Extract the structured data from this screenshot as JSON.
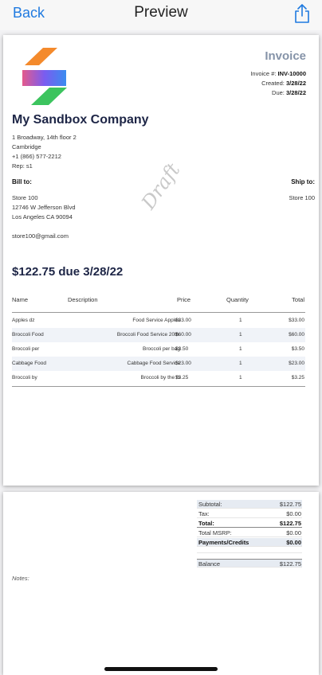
{
  "nav": {
    "back_label": "Back",
    "title": "Preview",
    "share_icon": "share-icon"
  },
  "invoice": {
    "title": "Invoice",
    "number_label": "Invoice #:",
    "number": "INV-10000",
    "created_label": "Created:",
    "created": "3/28/22",
    "due_label": "Due:",
    "due": "3/28/22"
  },
  "company": {
    "name": "My Sandbox Company",
    "address1": "1 Broadway, 14th floor 2",
    "city": "Cambridge",
    "phone": "+1 (866) 577-2212",
    "rep": "Rep: s1"
  },
  "bill_to": {
    "label": "Bill to:",
    "name": "Store 100",
    "street": "12746 W Jefferson Blvd",
    "city": "Los Angeles CA 90094",
    "email": "store100@gmail.com"
  },
  "ship_to": {
    "label": "Ship to:",
    "name": "Store 100"
  },
  "watermark": "Draft",
  "amount_due": "$122.75 due 3/28/22",
  "table": {
    "headers": {
      "name": "Name",
      "description": "Description",
      "price": "Price",
      "quantity": "Quantity",
      "total": "Total"
    },
    "rows": [
      {
        "name": "Apples dz",
        "description": "Food Service Apples",
        "price": "$33.00",
        "quantity": "1",
        "total": "$33.00"
      },
      {
        "name": "Broccoli Food",
        "description": "Broccoli Food Service 20lb.",
        "price": "$60.00",
        "quantity": "1",
        "total": "$60.00"
      },
      {
        "name": "Broccoli per",
        "description": "Broccoli per bag",
        "price": "$3.50",
        "quantity": "1",
        "total": "$3.50"
      },
      {
        "name": "Cabbage Food",
        "description": "Cabbage Food Service",
        "price": "$23.00",
        "quantity": "1",
        "total": "$23.00"
      },
      {
        "name": "Broccoli by",
        "description": "Broccoli by the lb",
        "price": "$3.25",
        "quantity": "1",
        "total": "$3.25"
      }
    ]
  },
  "summary": {
    "subtotal_label": "Subtotal:",
    "subtotal": "$122.75",
    "tax_label": "Tax:",
    "tax": "$0.00",
    "total_label": "Total:",
    "total": "$122.75",
    "msrp_label": "Total MSRP:",
    "msrp": "$0.00",
    "payments_label": "Payments/Credits",
    "payments": "$0.00",
    "balance_label": "Balance",
    "balance": "$122.75"
  },
  "notes_label": "Notes:",
  "colors": {
    "accent": "#1f7ae0",
    "heading": "#1d2546",
    "invoice_title": "#8593a8",
    "row_shade": "#f0f3f8"
  }
}
